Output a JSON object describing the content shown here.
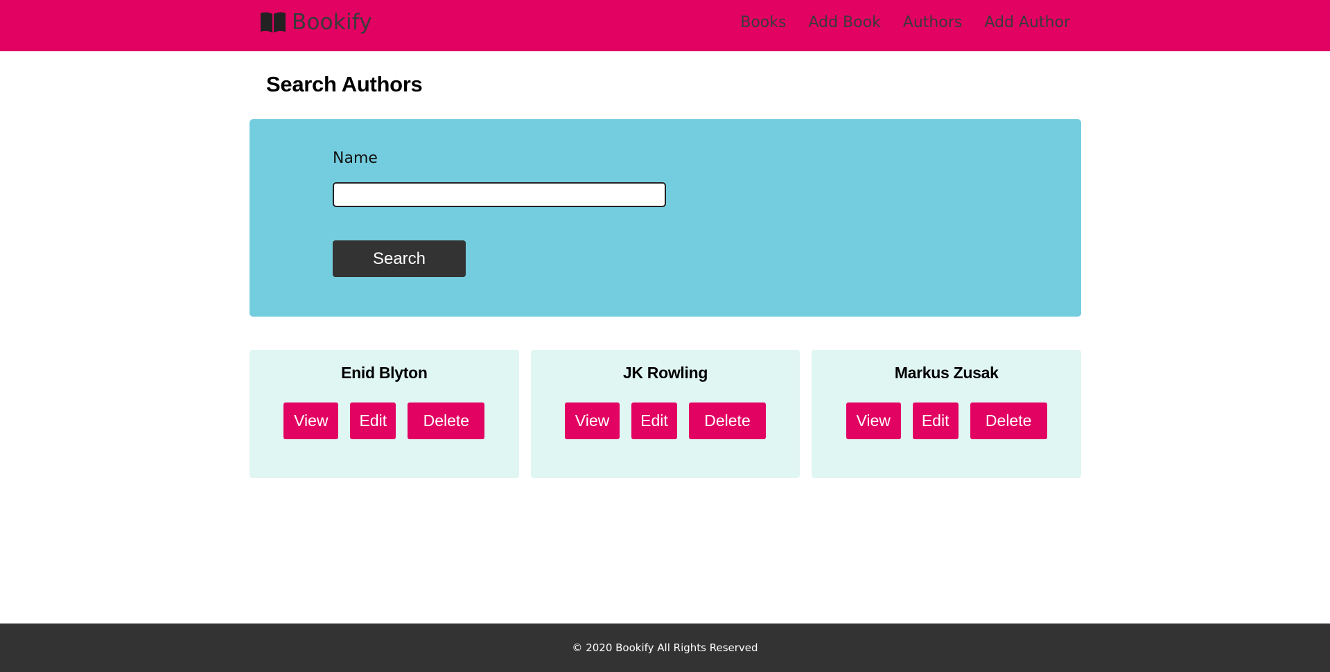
{
  "header": {
    "brand": "Bookify",
    "brand_icon": "open-book-icon",
    "nav": [
      {
        "label": "Books"
      },
      {
        "label": "Add Book"
      },
      {
        "label": "Authors"
      },
      {
        "label": "Add Author"
      }
    ]
  },
  "page": {
    "title": "Search Authors"
  },
  "search": {
    "name_label": "Name",
    "name_value": "",
    "name_placeholder": "",
    "button_label": "Search"
  },
  "authors": [
    {
      "name": "Enid Blyton",
      "view": "View",
      "edit": "Edit",
      "delete": "Delete"
    },
    {
      "name": "JK Rowling",
      "view": "View",
      "edit": "Edit",
      "delete": "Delete"
    },
    {
      "name": "Markus Zusak",
      "view": "View",
      "edit": "Edit",
      "delete": "Delete"
    }
  ],
  "footer": {
    "text": "© 2020 Bookify All Rights Reserved"
  },
  "colors": {
    "brand": "#e20262",
    "panel": "#74cddf",
    "card": "#e0f6f3",
    "dark": "#333333"
  }
}
